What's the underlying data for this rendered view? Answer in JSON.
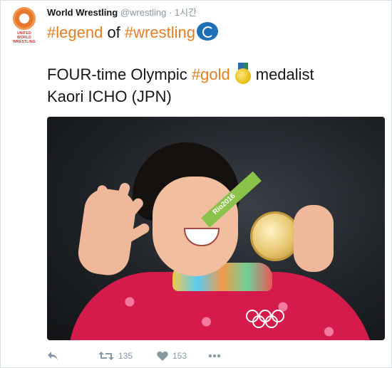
{
  "account": {
    "avatar_text": "UNITED WORLD WRESTLING",
    "name": "World Wrestling",
    "handle": "@wrestling",
    "separator": "·",
    "time": "1시간"
  },
  "tweet": {
    "line1": {
      "tag1": "#legend",
      "word_of": "of",
      "tag2": "#wrestling"
    },
    "line2": {
      "prefix": "FOUR-time Olympic",
      "tag": "#gold",
      "suffix": "medalist"
    },
    "line3": "Kaori ICHO (JPN)"
  },
  "media": {
    "lanyard_text": "Rio2016"
  },
  "actions": {
    "retweet_count": "135",
    "like_count": "153"
  },
  "colors": {
    "hashtag": "#e67e22",
    "muted": "#8899a6"
  },
  "icons": [
    "reply-icon",
    "retweet-icon",
    "heart-icon",
    "more-icon",
    "olympic-sport-icon",
    "gold-medal-icon"
  ]
}
